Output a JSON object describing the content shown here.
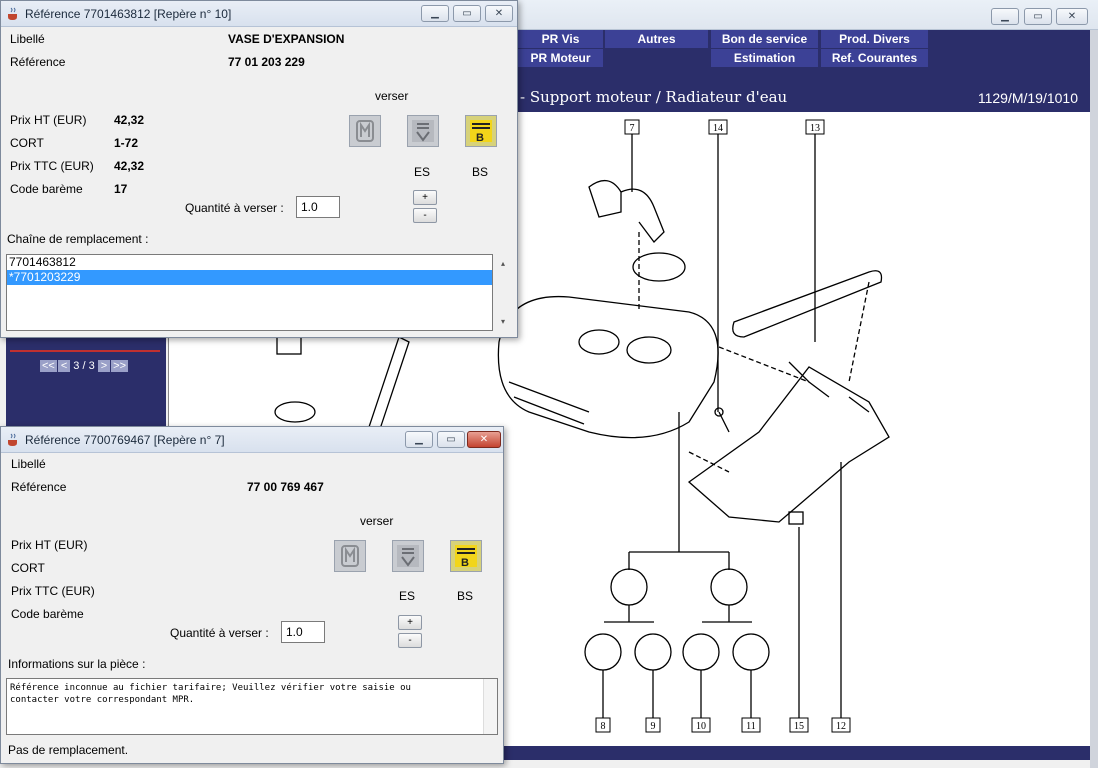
{
  "main": {
    "nav_row1": [
      "PR Vis",
      "Autres",
      "Bon de service",
      "Prod. Divers"
    ],
    "nav_row2": [
      "PR Moteur",
      "Estimation",
      "Ref. Courantes"
    ],
    "heading": "- Support moteur / Radiateur d'eau",
    "code": "1129/M/19/1010",
    "pager": {
      "first": "<<",
      "prev": "<",
      "text": "3 / 3",
      "next": ">",
      "last": ">>"
    },
    "callouts": [
      "7",
      "14",
      "13",
      "8",
      "9",
      "10",
      "11",
      "15",
      "12"
    ]
  },
  "dialog1": {
    "title": "Référence 7701463812 [Repère n° 10]",
    "libelle_label": "Libellé",
    "libelle_value": "VASE D'EXPANSION",
    "reference_label": "Référence",
    "reference_value": "77 01 203 229",
    "verser_label": "verser",
    "prix_ht_label": "Prix HT (EUR)",
    "prix_ht_value": "42,32",
    "cort_label": "CORT",
    "cort_value": "1-72",
    "prix_ttc_label": "Prix TTC (EUR)",
    "prix_ttc_value": "42,32",
    "code_bareme_label": "Code barème",
    "code_bareme_value": "17",
    "es_label": "ES",
    "bs_label": "BS",
    "qty_label": "Quantité à verser :",
    "qty_value": "1.0",
    "plus": "+",
    "minus": "-",
    "chaine_label": "Chaîne de remplacement :",
    "chain": [
      "7701463812",
      "*7701203229"
    ]
  },
  "dialog2": {
    "title": "Référence 7700769467 [Repère n° 7]",
    "libelle_label": "Libellé",
    "reference_label": "Référence",
    "reference_value": "77 00 769 467",
    "verser_label": "verser",
    "prix_ht_label": "Prix HT (EUR)",
    "cort_label": "CORT",
    "prix_ttc_label": "Prix TTC (EUR)",
    "code_bareme_label": "Code barème",
    "es_label": "ES",
    "bs_label": "BS",
    "qty_label": "Quantité à verser :",
    "qty_value": "1.0",
    "plus": "+",
    "minus": "-",
    "info_label": "Informations sur la pièce :",
    "info_text": "Référence inconnue au fichier tarifaire; Veuillez vérifier votre saisie ou\ncontacter votre correspondant MPR.",
    "footer": "Pas de remplacement."
  }
}
